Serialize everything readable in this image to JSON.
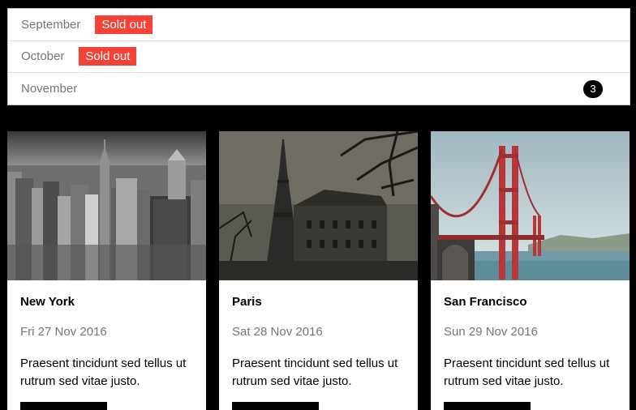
{
  "months": [
    {
      "name": "September",
      "badge": "Sold out"
    },
    {
      "name": "October",
      "badge": "Sold out"
    },
    {
      "name": "November",
      "count": "3"
    }
  ],
  "colors": {
    "sold_out": "#f44336",
    "page_bg": "#000000",
    "muted_text": "#757575"
  },
  "cards": [
    {
      "city": "New York",
      "date": "Fri 27 Nov 2016",
      "text": "Praesent tincidunt sed tellus ut rutrum sed vitae justo.",
      "image": "new-york-skyline-photo"
    },
    {
      "city": "Paris",
      "date": "Sat 28 Nov 2016",
      "text": "Praesent tincidunt sed tellus ut rutrum sed vitae justo.",
      "image": "paris-eiffel-tower-photo"
    },
    {
      "city": "San Francisco",
      "date": "Sun 29 Nov 2016",
      "text": "Praesent tincidunt sed tellus ut rutrum sed vitae justo.",
      "image": "golden-gate-bridge-photo"
    }
  ]
}
